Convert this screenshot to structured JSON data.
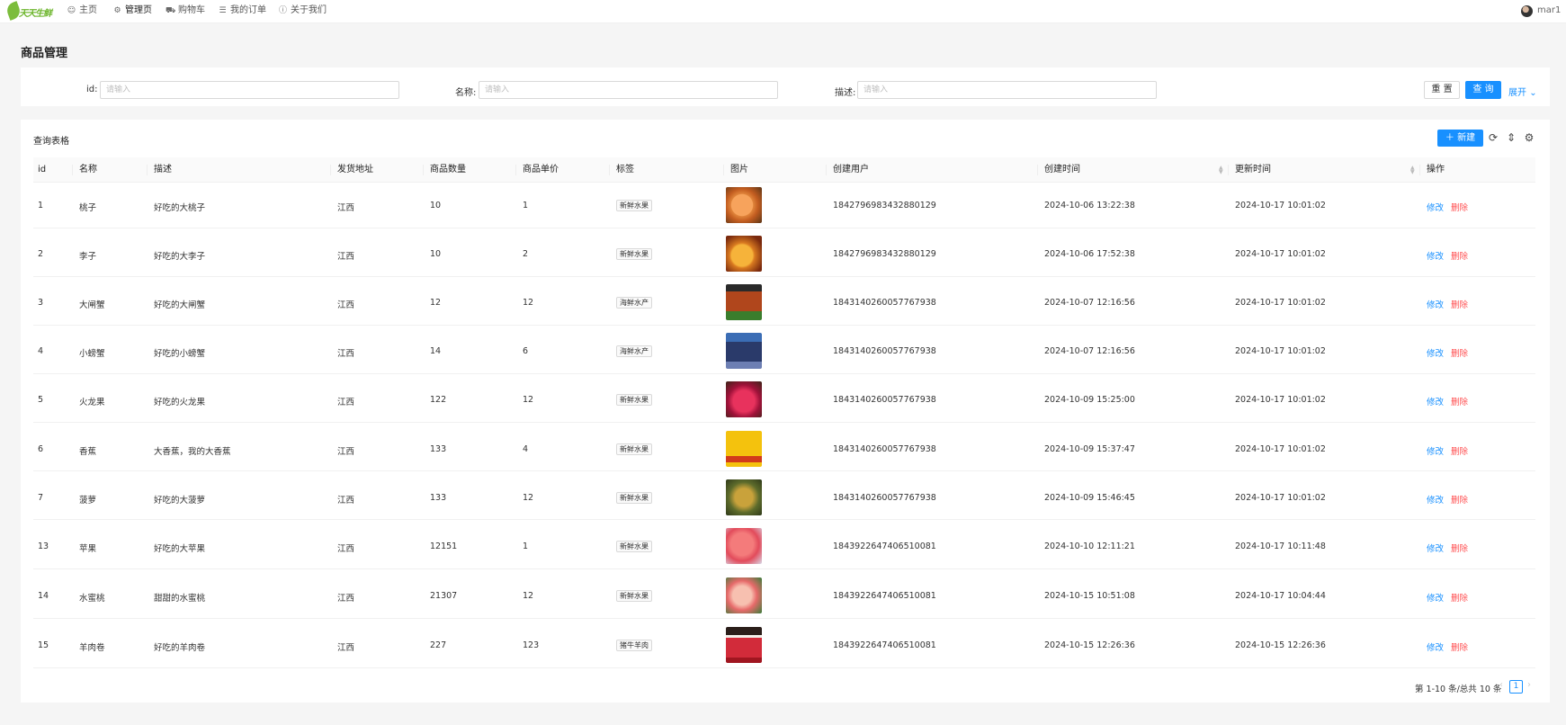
{
  "app": {
    "logo_text": "天天生鲜",
    "nav": [
      {
        "icon": "smile-icon",
        "label": "主页"
      },
      {
        "icon": "gear-icon",
        "label": "管理页"
      },
      {
        "icon": "cart-icon",
        "label": "购物车"
      },
      {
        "icon": "list-icon",
        "label": "我的订单"
      },
      {
        "icon": "info-icon",
        "label": "关于我们"
      }
    ],
    "active_nav": "管理页",
    "username": "mar1"
  },
  "page_title": "商品管理",
  "search": {
    "id_label": "id:",
    "id_placeholder": "请输入",
    "name_label": "名称:",
    "name_placeholder": "请输入",
    "desc_label": "描述:",
    "desc_placeholder": "请输入",
    "reset_label": "重 置",
    "query_label": "查 询",
    "expand_label": "展开"
  },
  "table": {
    "title": "查询表格",
    "new_label": "新建",
    "tools": [
      "reload-icon",
      "density-icon",
      "settings-icon"
    ],
    "columns": [
      "id",
      "名称",
      "描述",
      "发货地址",
      "商品数量",
      "商品单价",
      "标签",
      "图片",
      "创建用户",
      "创建时间",
      "更新时间",
      "操作"
    ],
    "sortable_columns": [
      "创建时间",
      "更新时间"
    ],
    "edit_label": "修改",
    "delete_label": "删除",
    "rows": [
      {
        "id": "1",
        "name": "桃子",
        "desc": "好吃的大桃子",
        "addr": "江西",
        "qty": "10",
        "price": "1",
        "tag": "新鲜水果",
        "img": "peach-image",
        "user": "1842796983432880129",
        "created": "2024-10-06 13:22:38",
        "updated": "2024-10-17 10:01:02"
      },
      {
        "id": "2",
        "name": "李子",
        "desc": "好吃的大李子",
        "addr": "江西",
        "qty": "10",
        "price": "2",
        "tag": "新鲜水果",
        "img": "plum-image",
        "user": "1842796983432880129",
        "created": "2024-10-06 17:52:38",
        "updated": "2024-10-17 10:01:02"
      },
      {
        "id": "3",
        "name": "大闸蟹",
        "desc": "好吃的大闸蟹",
        "addr": "江西",
        "qty": "12",
        "price": "12",
        "tag": "海鲜水产",
        "img": "hairy-crab-image",
        "user": "1843140260057767938",
        "created": "2024-10-07 12:16:56",
        "updated": "2024-10-17 10:01:02"
      },
      {
        "id": "4",
        "name": "小螃蟹",
        "desc": "好吃的小螃蟹",
        "addr": "江西",
        "qty": "14",
        "price": "6",
        "tag": "海鲜水产",
        "img": "small-crab-image",
        "user": "1843140260057767938",
        "created": "2024-10-07 12:16:56",
        "updated": "2024-10-17 10:01:02"
      },
      {
        "id": "5",
        "name": "火龙果",
        "desc": "好吃的火龙果",
        "addr": "江西",
        "qty": "122",
        "price": "12",
        "tag": "新鲜水果",
        "img": "dragon-fruit-image",
        "user": "1843140260057767938",
        "created": "2024-10-09 15:25:00",
        "updated": "2024-10-17 10:01:02"
      },
      {
        "id": "6",
        "name": "香蕉",
        "desc": "大香蕉，我的大香蕉",
        "addr": "江西",
        "qty": "133",
        "price": "4",
        "tag": "新鲜水果",
        "img": "banana-image",
        "user": "1843140260057767938",
        "created": "2024-10-09 15:37:47",
        "updated": "2024-10-17 10:01:02"
      },
      {
        "id": "7",
        "name": "菠萝",
        "desc": "好吃的大菠萝",
        "addr": "江西",
        "qty": "133",
        "price": "12",
        "tag": "新鲜水果",
        "img": "pineapple-image",
        "user": "1843140260057767938",
        "created": "2024-10-09 15:46:45",
        "updated": "2024-10-17 10:01:02"
      },
      {
        "id": "13",
        "name": "苹果",
        "desc": "好吃的大苹果",
        "addr": "江西",
        "qty": "12151",
        "price": "1",
        "tag": "新鲜水果",
        "img": "apple-image",
        "user": "1843922647406510081",
        "created": "2024-10-10 12:11:21",
        "updated": "2024-10-17 10:11:48"
      },
      {
        "id": "14",
        "name": "水蜜桃",
        "desc": "甜甜的水蜜桃",
        "addr": "江西",
        "qty": "21307",
        "price": "12",
        "tag": "新鲜水果",
        "img": "honey-peach-image",
        "user": "1843922647406510081",
        "created": "2024-10-15 10:51:08",
        "updated": "2024-10-17 10:04:44"
      },
      {
        "id": "15",
        "name": "羊肉卷",
        "desc": "好吃的羊肉卷",
        "addr": "江西",
        "qty": "227",
        "price": "123",
        "tag": "猪牛羊肉",
        "img": "lamb-roll-image",
        "user": "1843922647406510081",
        "created": "2024-10-15 12:26:36",
        "updated": "2024-10-15 12:26:36"
      }
    ]
  },
  "pagination": {
    "total_text": "第 1-10 条/总共 10 条",
    "current_page": "1"
  }
}
